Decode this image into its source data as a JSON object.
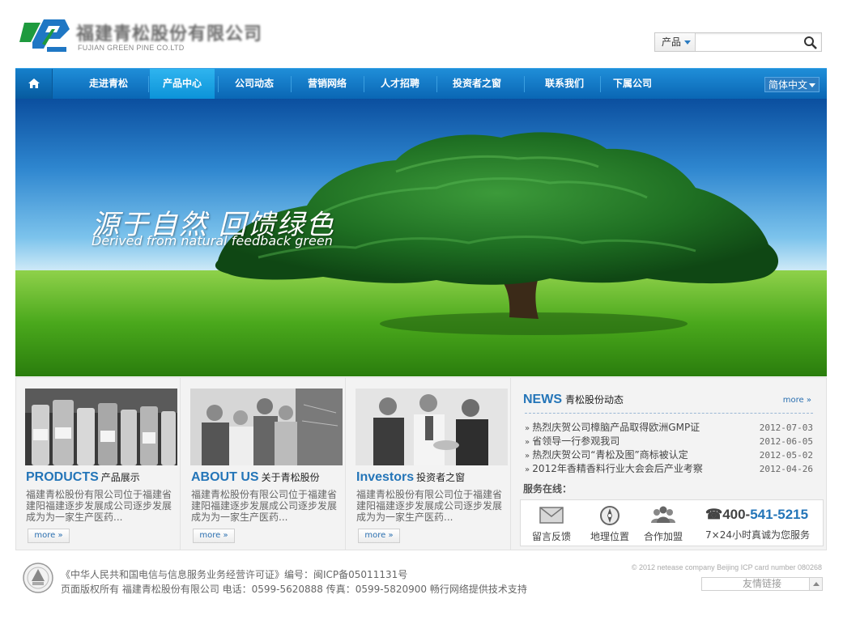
{
  "header": {
    "logo_en": "FUJIAN GREEN PINE CO.LTD",
    "logo_cn": "福建青松股份有限公司",
    "search": {
      "category": "产品",
      "placeholder": ""
    }
  },
  "nav": {
    "items": [
      {
        "label": "走进青松"
      },
      {
        "label": "产品中心"
      },
      {
        "label": "公司动态"
      },
      {
        "label": "营销网络"
      },
      {
        "label": "人才招聘"
      },
      {
        "label": "投资者之窗"
      },
      {
        "label": "联系我们"
      },
      {
        "label": "下属公司"
      }
    ],
    "active_index": 1,
    "language": "简体中文"
  },
  "banner": {
    "slogan_cn": "源于自然  回馈绿色",
    "slogan_en": "Derived from natural feedback green"
  },
  "columns": [
    {
      "title_en": "PRODUCTS",
      "title_cn": "产品展示",
      "desc": "福建青松股份有限公司位于福建省建阳福建逐步发展成公司逐步发展成为为一家生产医药...",
      "more": "more"
    },
    {
      "title_en": "ABOUT US",
      "title_cn": "关于青松股份",
      "desc": "福建青松股份有限公司位于福建省建阳福建逐步发展成公司逐步发展成为为一家生产医药...",
      "more": "more"
    },
    {
      "title_en": "Investors",
      "title_cn": "投资者之窗",
      "desc": "福建青松股份有限公司位于福建省建阳福建逐步发展成公司逐步发展成为为一家生产医药...",
      "more": "more"
    }
  ],
  "news": {
    "title_en": "NEWS",
    "title_cn": "青松股份动态",
    "more": "more",
    "items": [
      {
        "title": "热烈庆贺公司樟脑产品取得欧洲GMP证",
        "date": "2012-07-03"
      },
      {
        "title": "省领导一行参观我司",
        "date": "2012-06-05"
      },
      {
        "title": "热烈庆贺公司“青松及图”商标被认定",
        "date": "2012-05-02"
      },
      {
        "title": "2012年香精香料行业大会会后产业考察",
        "date": "2012-04-26"
      }
    ]
  },
  "service": {
    "label": "服务在线：",
    "items": [
      {
        "label": "留言反馈",
        "icon": "envelope-icon"
      },
      {
        "label": "地理位置",
        "icon": "compass-icon"
      },
      {
        "label": "合作加盟",
        "icon": "people-icon"
      }
    ],
    "phone_prefix": "400-",
    "phone_highlight": "541-5215",
    "phone_sub": "7×24小时真诚为您服务"
  },
  "footer": {
    "line1": "《中华人民共和国电信与信息服务业务经营许可证》编号：闽ICP备05011131号",
    "line2": "页面版权所有  福建青松股份有限公司  电话：0599-5620888  传真：0599-5820900  畅行网络提供技术支持",
    "copyright": "© 2012 netease company Beijing ICP card number 080268",
    "links_label": "友情链接"
  }
}
